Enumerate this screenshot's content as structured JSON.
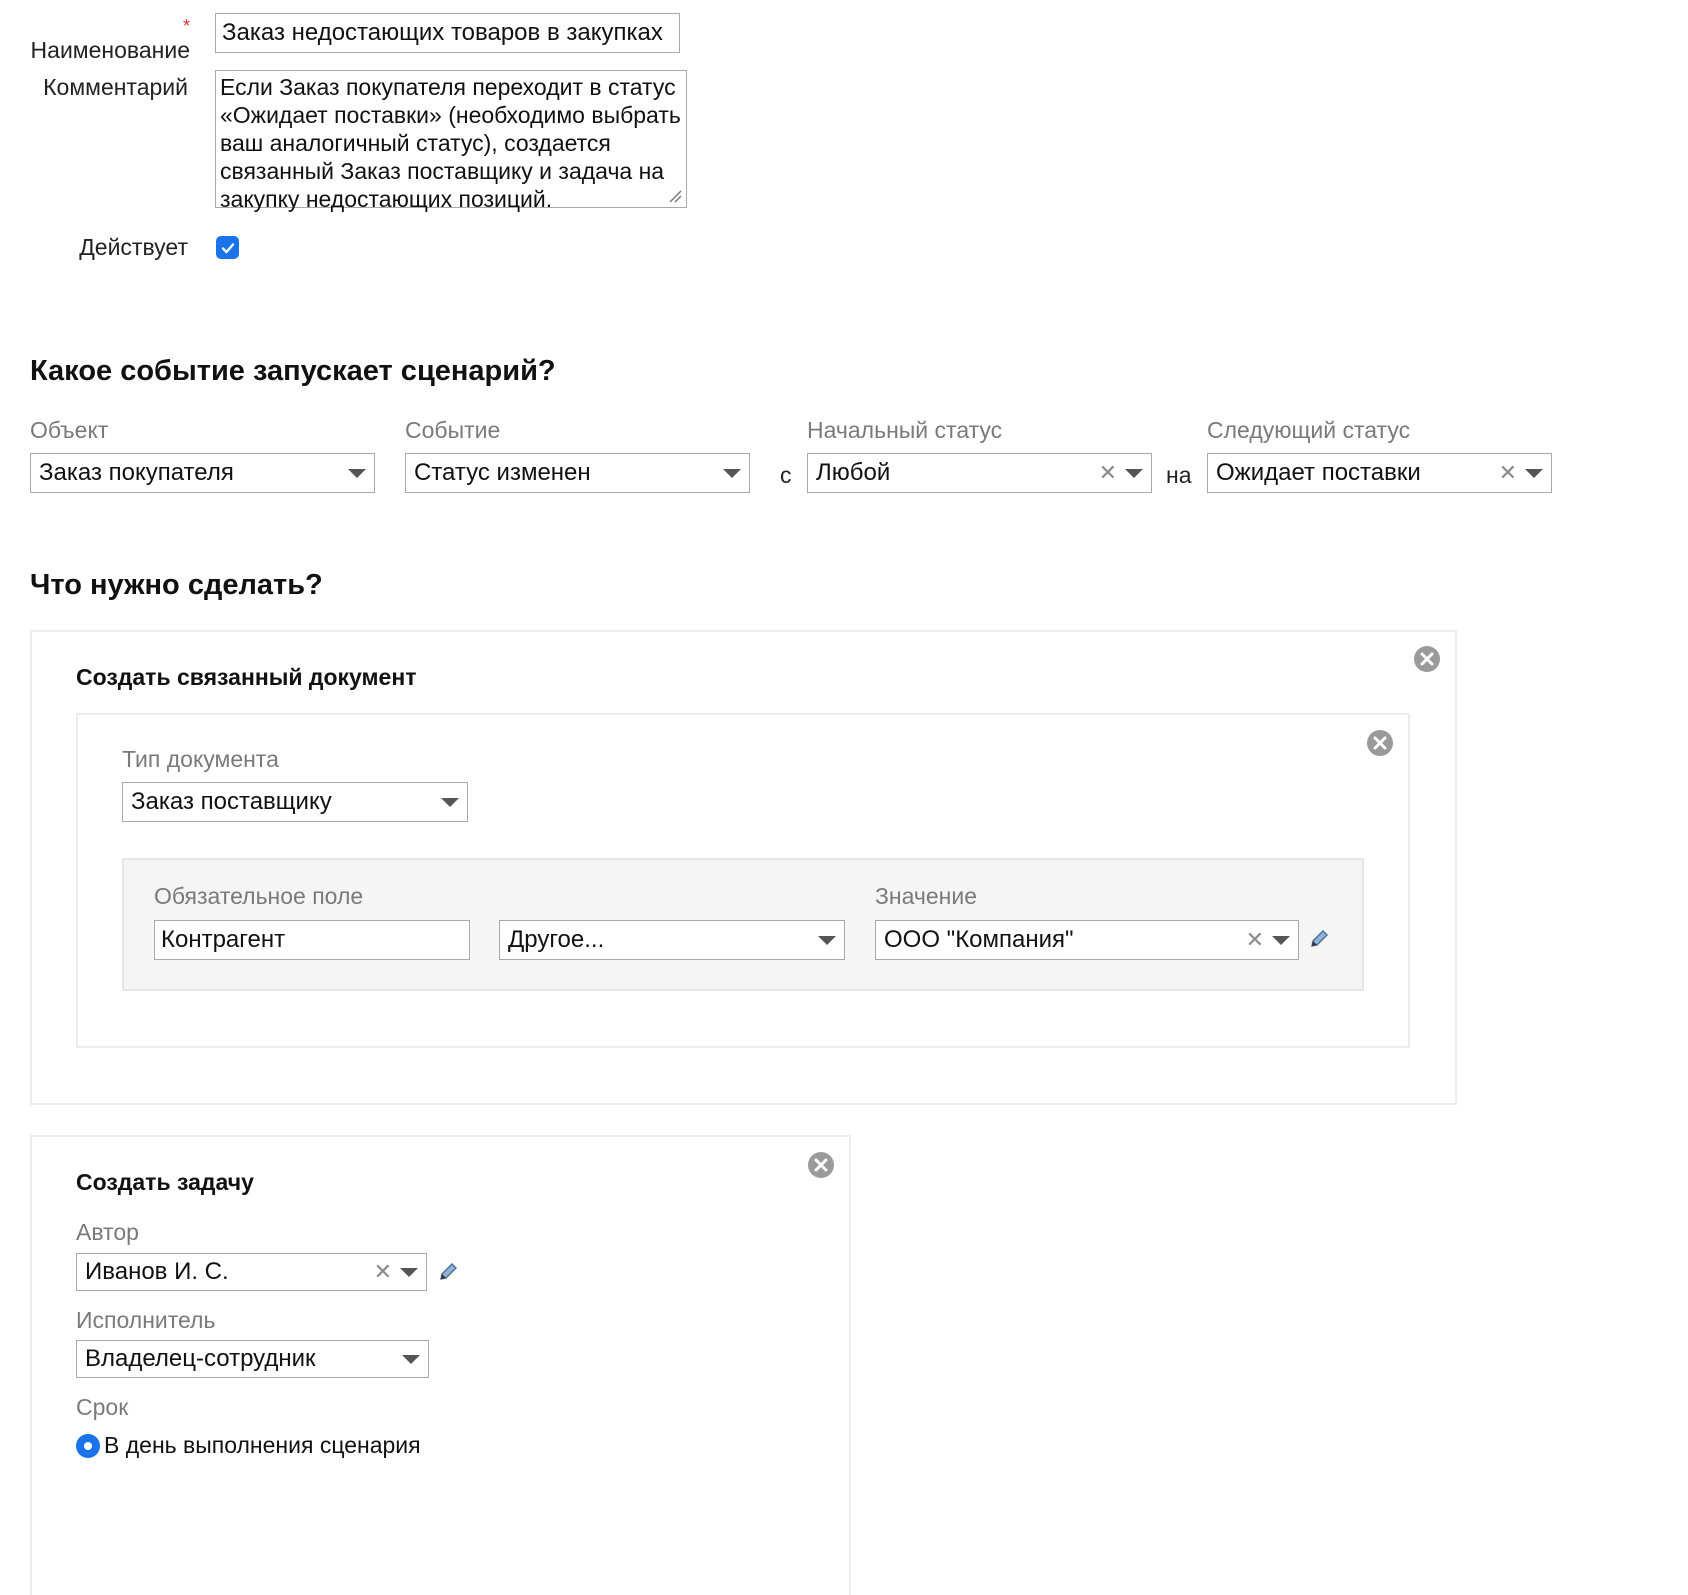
{
  "general": {
    "name_label": "Наименование",
    "required_mark": "*",
    "name_value": "Заказ недостающих товаров в закупках",
    "comment_label": "Комментарий",
    "comment_value": "Если Заказ покупателя переходит в статус «Ожидает поставки» (необходимо выбрать ваш аналогичный статус), создается связанный Заказ поставщику и задача на закупку недостающих позиций.",
    "active_label": "Действует",
    "active_checked": true
  },
  "trigger": {
    "heading": "Какое событие запускает сценарий?",
    "object_label": "Объект",
    "object_value": "Заказ покупателя",
    "event_label": "Событие",
    "event_value": "Статус изменен",
    "from_word": "с",
    "start_status_label": "Начальный статус",
    "start_status_value": "Любой",
    "to_word": "на",
    "next_status_label": "Следующий статус",
    "next_status_value": "Ожидает поставки"
  },
  "actions": {
    "heading": "Что нужно сделать?",
    "linked_doc": {
      "title": "Создать связанный документ",
      "doc_type_label": "Тип документа",
      "doc_type_value": "Заказ поставщику",
      "required_field_label": "Обязательное поле",
      "required_field_value": "Контрагент",
      "source_value": "Другое...",
      "value_label": "Значение",
      "value_value": "ООО \"Компания\""
    },
    "task": {
      "title": "Создать задачу",
      "author_label": "Автор",
      "author_value": "Иванов И. С.",
      "assignee_label": "Исполнитель",
      "assignee_value": "Владелец-сотрудник",
      "deadline_label": "Срок",
      "deadline_option": "В день выполнения сценария"
    }
  },
  "colors": {
    "accent": "#1a73e8",
    "required": "#e0322b"
  }
}
